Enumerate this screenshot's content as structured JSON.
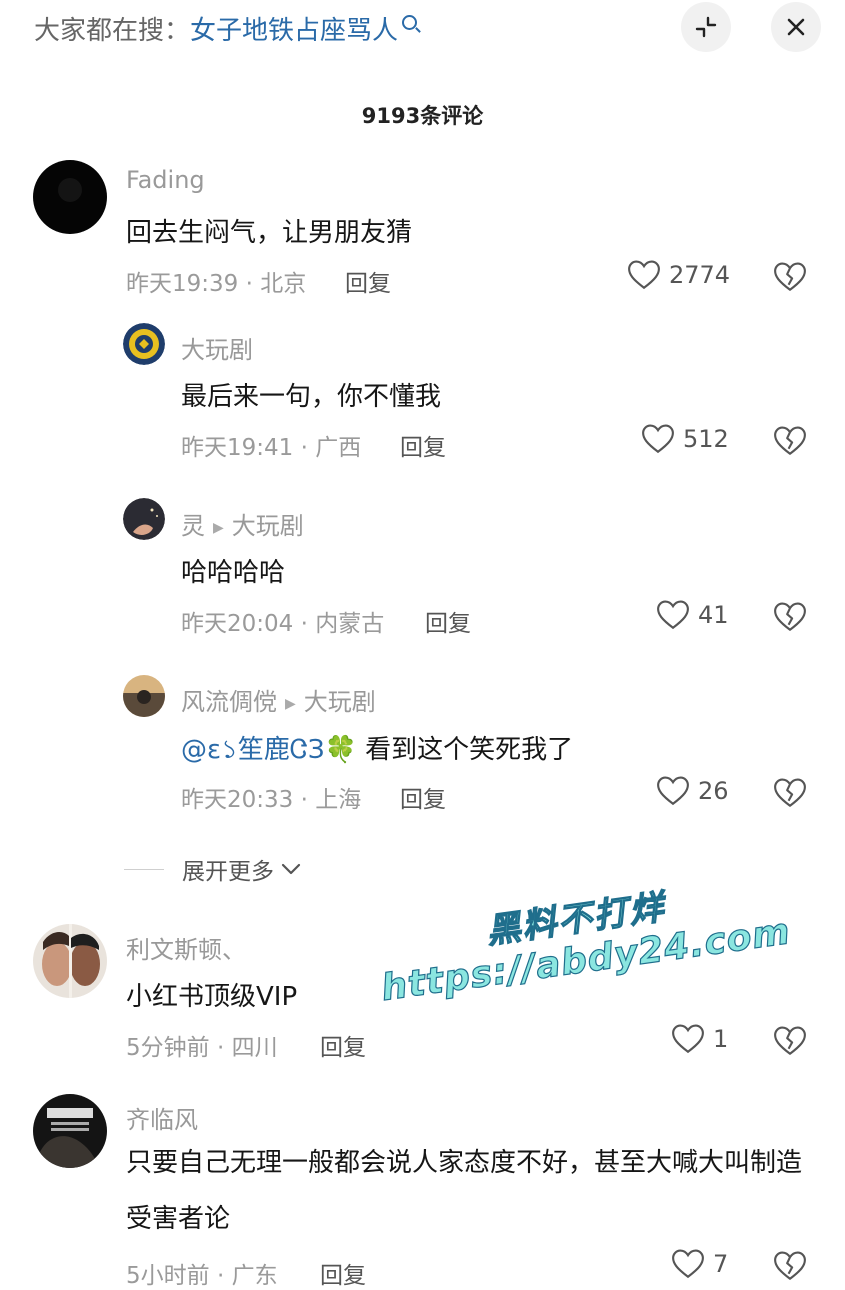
{
  "search": {
    "prefix": "大家都在搜：",
    "term": "女子地铁占座骂人"
  },
  "header": {
    "comment_count": "9193条评论"
  },
  "comments": [
    {
      "user": "Fading",
      "text": "回去生闷气，让男朋友猜",
      "time": "昨天19:39 · 北京",
      "reply": "回复",
      "likes": "2774",
      "replies": [
        {
          "user": "大玩剧",
          "text": "最后来一句，你不懂我",
          "time": "昨天19:41 · 广西",
          "reply": "回复",
          "likes": "512"
        },
        {
          "user": "灵",
          "reply_to": "大玩剧",
          "text": "哈哈哈哈",
          "time": "昨天20:04 · 内蒙古",
          "reply": "回复",
          "likes": "41"
        },
        {
          "user": "风流倜傥",
          "reply_to": "大玩剧",
          "mention": "@ε১笙鹿ᏣЗ",
          "text": "看到这个笑死我了",
          "time": "昨天20:33 · 上海",
          "reply": "回复",
          "likes": "26"
        }
      ],
      "expand_label": "展开更多"
    },
    {
      "user": "利文斯顿、",
      "text": "小红书顶级VIP",
      "time": "5分钟前 · 四川",
      "reply": "回复",
      "likes": "1"
    },
    {
      "user": "齐临风",
      "text": "只要自己无理一般都会说人家态度不好，甚至大喊大叫制造受害者论",
      "time": "5小时前 · 广东",
      "reply": "回复",
      "likes": "7"
    }
  ],
  "watermark": {
    "line1": "黑料不打烊",
    "line2": "https://abdy24.com"
  },
  "icons": {
    "search": "search-icon",
    "collapse": "collapse-icon",
    "close": "close-icon",
    "like": "heart-icon",
    "dislike": "broken-heart-icon",
    "expand": "chevron-down-icon"
  },
  "colors": {
    "link": "#2a6aa8",
    "muted": "#9a9a9a",
    "watermark": "#8be6e0"
  }
}
